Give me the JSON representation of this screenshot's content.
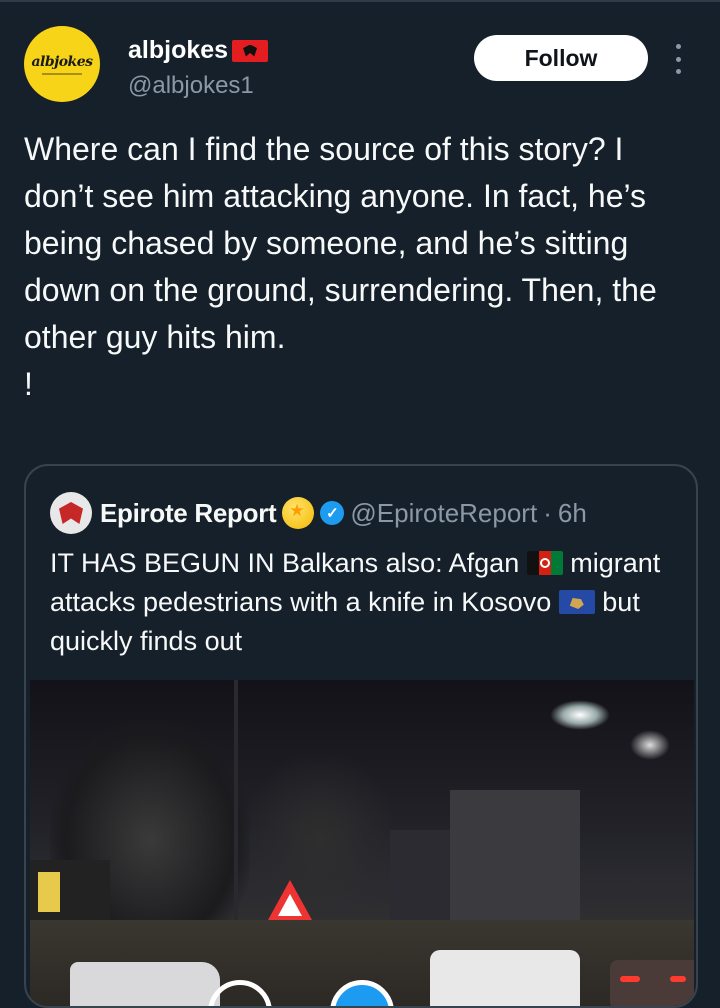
{
  "tweet": {
    "author": {
      "display_name": "albjokes",
      "flag_icon": "albania-flag-icon",
      "handle": "@albjokes1",
      "avatar_text": "albjokes",
      "avatar_color": "#f7d417"
    },
    "follow_label": "Follow",
    "more_icon": "more-vertical-icon",
    "text": "Where can I find the source of this story? I don’t see him attacking anyone. In fact, he’s being chased by someone, and he’s sitting down on the ground, surrendering. Then, the other guy hits him.\n!"
  },
  "quote": {
    "display_name": "Epirote Report",
    "handle": "@EpiroteReport",
    "separator": "·",
    "time": "6h",
    "verified_color": "#1d9bf0",
    "text_part1": "IT HAS BEGUN IN Balkans also: Afgan ",
    "text_part2": " migrant attacks pedestrians with a knife in Kosovo ",
    "text_part3": " but quickly finds out",
    "media": "video-thumbnail"
  },
  "colors": {
    "background": "#15202b",
    "secondary_text": "#8b98a5",
    "border": "#38444d"
  }
}
